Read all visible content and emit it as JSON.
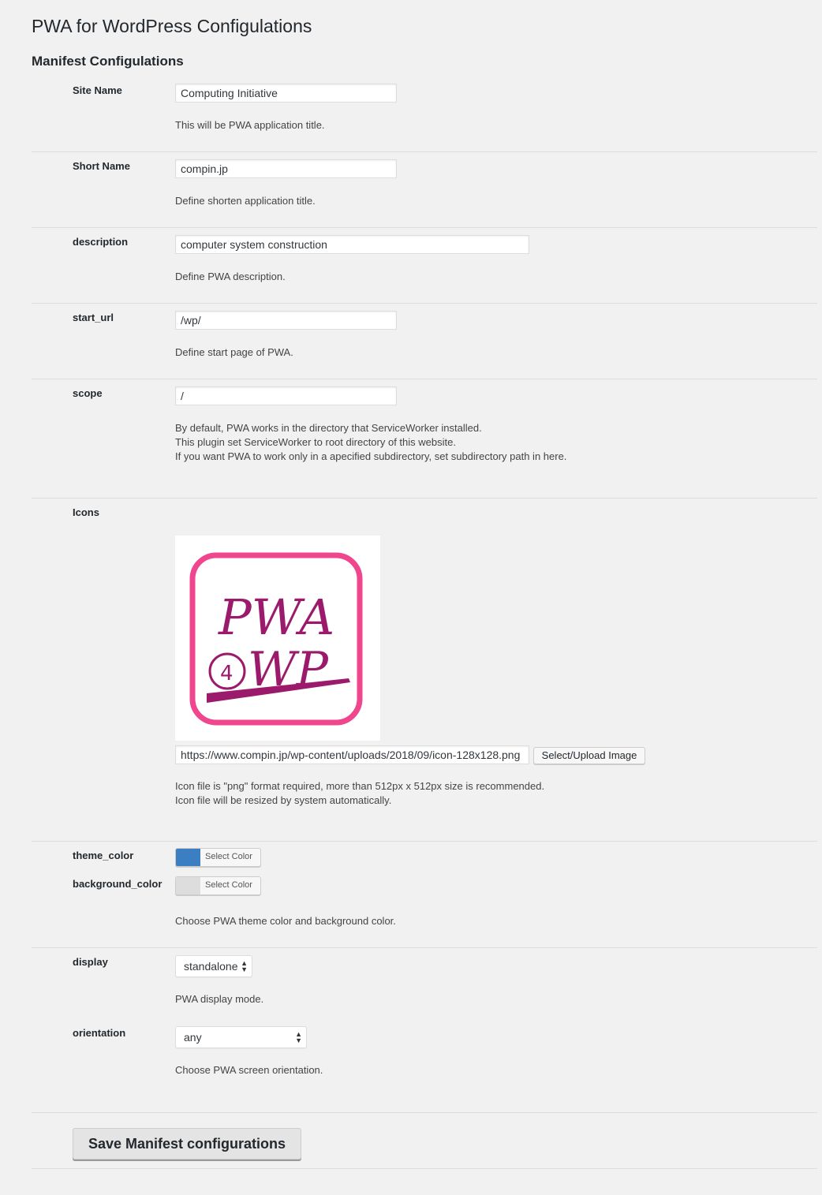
{
  "page": {
    "title": "PWA for WordPress Configulations"
  },
  "section": {
    "title": "Manifest Configulations"
  },
  "fields": {
    "site_name": {
      "label": "Site Name",
      "value": "Computing Initiative",
      "desc": "This will be PWA application title."
    },
    "short_name": {
      "label": "Short Name",
      "value": "compin.jp",
      "desc": "Define shorten application title."
    },
    "description": {
      "label": "description",
      "value": "computer system construction",
      "desc": "Define PWA description."
    },
    "start_url": {
      "label": "start_url",
      "value": "/wp/",
      "desc": "Define start page of PWA."
    },
    "scope": {
      "label": "scope",
      "value": "/",
      "desc_lines": [
        "By default, PWA works in the directory that ServiceWorker installed.",
        "This plugin set ServiceWorker to root directory of this website.",
        "If you want PWA to work only in a apecified subdirectory, set subdirectory path in here."
      ]
    },
    "icons": {
      "label": "Icons",
      "url": "https://www.compin.jp/wp-content/uploads/2018/09/icon-128x128.png",
      "button_label": "Select/Upload Image",
      "desc_lines": [
        "Icon file is \"png\" format required, more than 512px x 512px size is recommended.",
        "Icon file will be resized by system automatically."
      ],
      "preview_logo_text": "PWA @WP"
    },
    "theme_color": {
      "label": "theme_color",
      "button_label": "Select Color",
      "color": "#3b7ec2"
    },
    "background_color": {
      "label": "background_color",
      "button_label": "Select Color",
      "color": "#dddddd"
    },
    "colors_desc": "Choose PWA theme color and background color.",
    "display": {
      "label": "display",
      "selected": "standalone",
      "desc": "PWA display mode."
    },
    "orientation": {
      "label": "orientation",
      "selected": "any",
      "desc": "Choose PWA screen orientation."
    }
  },
  "save_button_label": "Save Manifest configurations"
}
